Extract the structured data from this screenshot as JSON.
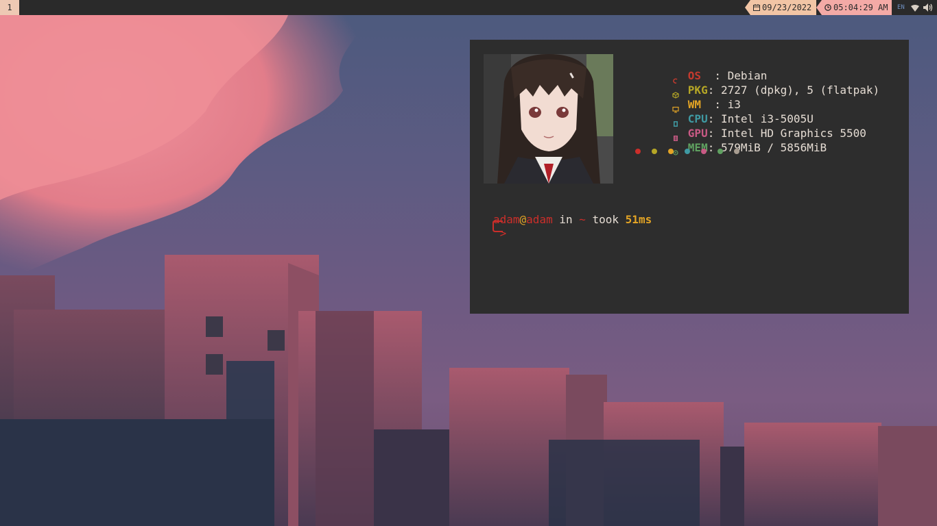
{
  "topbar": {
    "workspace": "1",
    "date": "09/23/2022",
    "time": "05:04:29 AM",
    "keyboard_layout": "EN",
    "icons": [
      "calendar-icon",
      "clock-icon",
      "wifi-icon",
      "volume-icon"
    ]
  },
  "terminal": {
    "fetch": [
      {
        "key": "OS",
        "sep": "  : ",
        "value": "Debian",
        "color": "#c43a2e",
        "icon": "debian-icon"
      },
      {
        "key": "PKG",
        "sep": ": ",
        "value": "2727 (dpkg), 5 (flatpak)",
        "color": "#b5a626",
        "icon": "package-icon"
      },
      {
        "key": "WM",
        "sep": "  : ",
        "value": "i3",
        "color": "#e3a425",
        "icon": "monitor-icon"
      },
      {
        "key": "CPU",
        "sep": ": ",
        "value": "Intel i3-5005U",
        "color": "#3f9aa3",
        "icon": "cpu-icon"
      },
      {
        "key": "GPU",
        "sep": ": ",
        "value": "Intel HD Graphics 5500",
        "color": "#c95a85",
        "icon": "gpu-icon"
      },
      {
        "key": "MEM",
        "sep": ": ",
        "value": "579MiB / 5856MiB",
        "color": "#5fa060",
        "icon": "memory-icon"
      }
    ],
    "palette": [
      "#cc2e2a",
      "#b5a626",
      "#e3a425",
      "#3f9aa3",
      "#c95a85",
      "#5fa060",
      "#a79c90"
    ],
    "prompt": {
      "user": "adam",
      "at": "@",
      "host": "adam",
      "in": " in ",
      "dir": "~",
      "took": " took ",
      "duration": "51ms",
      "arrow": ">"
    },
    "colors": {
      "user": "#cc2e2a",
      "at": "#e3a425",
      "host": "#cc2e2a",
      "dir": "#cc2e2a",
      "duration": "#e3a425"
    }
  }
}
